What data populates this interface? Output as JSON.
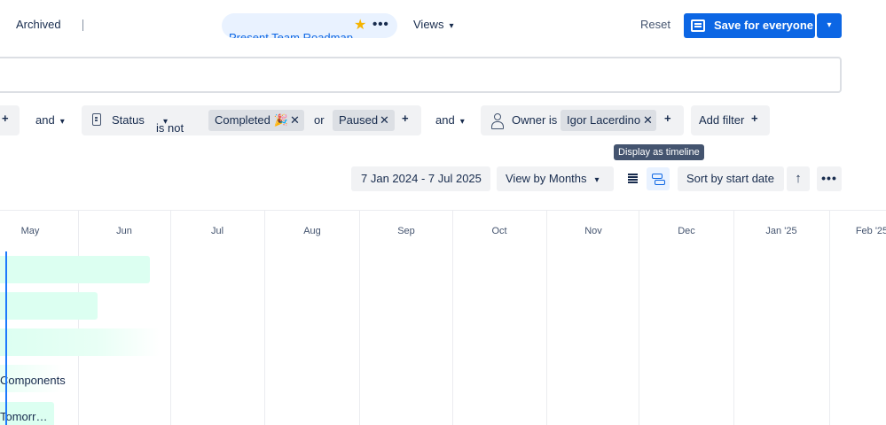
{
  "header": {
    "archived_label": "Archived",
    "view_title": "Present Team Roadmap",
    "views_label": "Views",
    "reset_label": "Reset",
    "save_label": "Save for everyone"
  },
  "filters": {
    "and_1": "and",
    "status_label": "Status",
    "status_operator": "is not",
    "status_value_1": "Completed 🎉",
    "or_label": "or",
    "status_value_2": "Paused",
    "and_2": "and",
    "owner_label": "Owner is",
    "owner_value": "Igor Lacerdino",
    "add_filter_label": "Add filter"
  },
  "toolbar": {
    "tooltip": "Display as timeline",
    "date_range": "7 Jan 2024 - 7 Jul 2025",
    "view_by": "View by Months",
    "sort": "Sort by start date"
  },
  "timeline": {
    "months": [
      "May",
      "Jun",
      "Jul",
      "Aug",
      "Sep",
      "Oct",
      "Nov",
      "Dec",
      "Jan '25",
      "Feb '25"
    ],
    "items": [
      {
        "label": ""
      },
      {
        "label": ""
      },
      {
        "label": ""
      },
      {
        "label": "Components"
      },
      {
        "label": "Tomorr…"
      }
    ]
  },
  "colors": {
    "accent": "#0c66e4",
    "bar": "#dcfff1",
    "today_line": "#1d7afc"
  }
}
